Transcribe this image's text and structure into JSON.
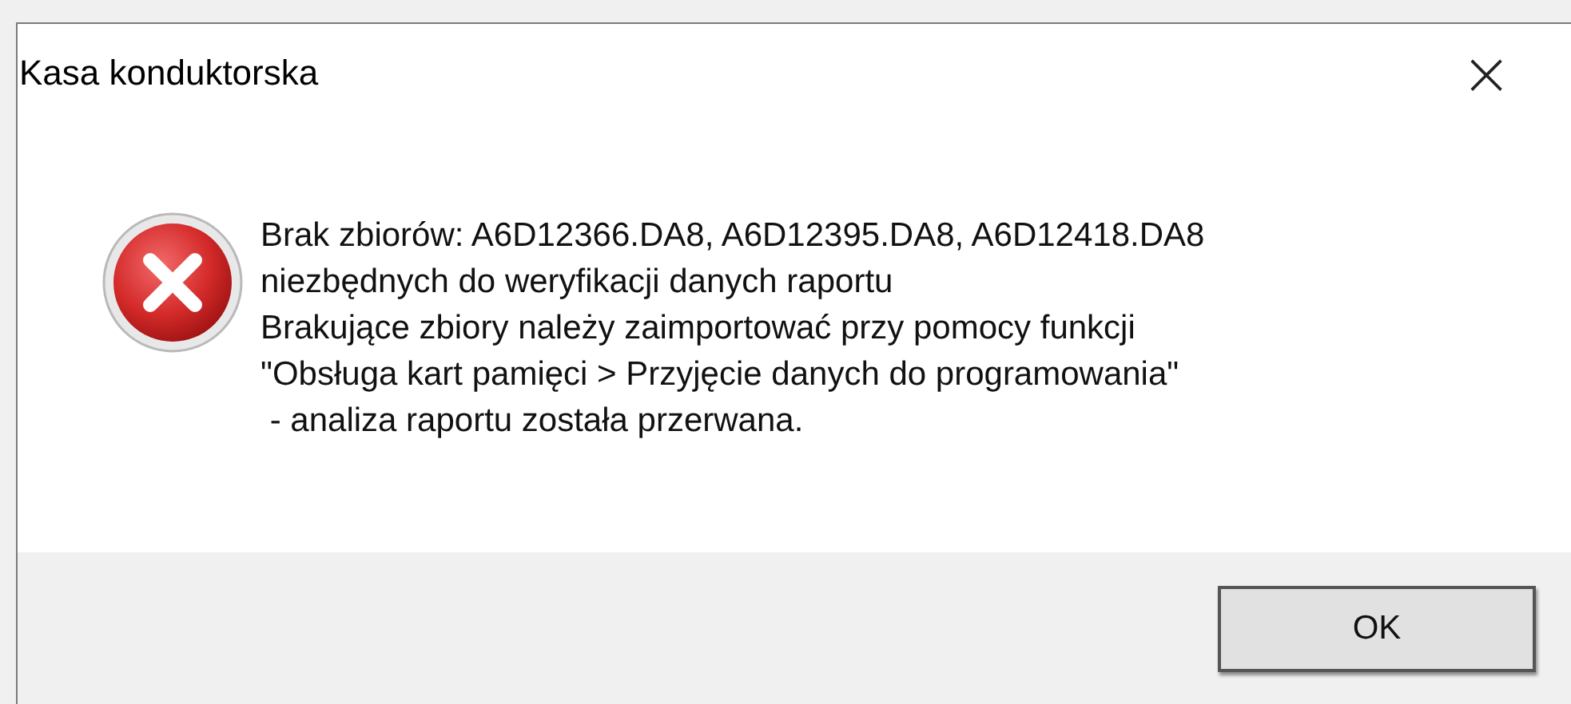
{
  "window": {
    "title": "Kasa konduktorska",
    "close": "×"
  },
  "message": {
    "kind": "error",
    "lines": [
      "Brak zbiorów: A6D12366.DA8, A6D12395.DA8, A6D12418.DA8",
      "niezbędnych do weryfikacji danych raportu",
      "Brakujące zbiory należy zaimportować przy pomocy funkcji",
      "\"Obsługa kart pamięci > Przyjęcie danych do programowania\"",
      " - analiza raportu została przerwana."
    ]
  },
  "buttons": [
    {
      "label": "OK",
      "selected": true
    }
  ]
}
